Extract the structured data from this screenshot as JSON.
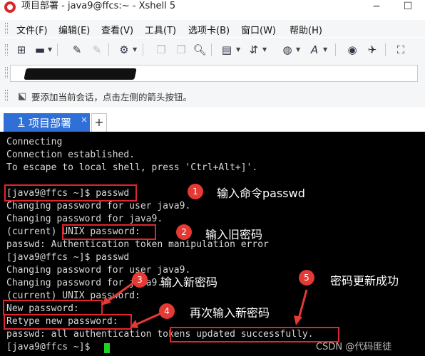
{
  "window": {
    "title": "项目部署 - java9@ffcs:~ - Xshell 5",
    "minimize": "−",
    "maximize": "☐"
  },
  "menu": [
    "文件(F)",
    "编辑(E)",
    "查看(V)",
    "工具(T)",
    "选项卡(B)",
    "窗口(W)",
    "帮助(H)"
  ],
  "toolbar_icons": [
    "new-session-icon",
    "open-folder-icon",
    "reconnect-icon",
    "disconnect-icon",
    "properties-icon",
    "copy-icon",
    "paste-icon",
    "find-icon",
    "print-icon",
    "transfer-icon",
    "globe-icon",
    "font-icon",
    "xftp-icon",
    "xmanager-icon",
    "fullscreen-icon"
  ],
  "address_bar": {
    "value_redacted": true
  },
  "info_bar": {
    "text": "要添加当前会话，点击左侧的箭头按钮。"
  },
  "tabs": [
    {
      "number": "1",
      "label": "项目部署",
      "close": "×",
      "active": true
    }
  ],
  "tab_add": "+",
  "terminal": {
    "lines": [
      "Connecting",
      "Connection established.",
      "To escape to local shell, press 'Ctrl+Alt+]'.",
      "",
      "[java9@ffcs ~]$ passwd",
      "Changing password for user java9.",
      "Changing password for java9.",
      "(current) UNIX password:",
      "passwd: Authentication token manipulation error",
      "[java9@ffcs ~]$ passwd",
      "Changing password for user java9.",
      "Changing password for java9.",
      "(current) UNIX password:",
      "New password:",
      "Retype new password:",
      "passwd: all authentication tokens updated successfully.",
      "[java9@ffcs ~]$ "
    ],
    "cursor_color": "#1fd41f"
  },
  "annotations": [
    {
      "number": "1",
      "text": "输入命令passwd"
    },
    {
      "number": "2",
      "text": "输入旧密码"
    },
    {
      "number": "3",
      "text": "输入新密码"
    },
    {
      "number": "4",
      "text": "再次输入新密码"
    },
    {
      "number": "5",
      "text": "密码更新成功"
    }
  ],
  "annotation_color": "#e0262d",
  "accent_color": "#2f6fd6",
  "watermark": "CSDN @代码匪徒"
}
